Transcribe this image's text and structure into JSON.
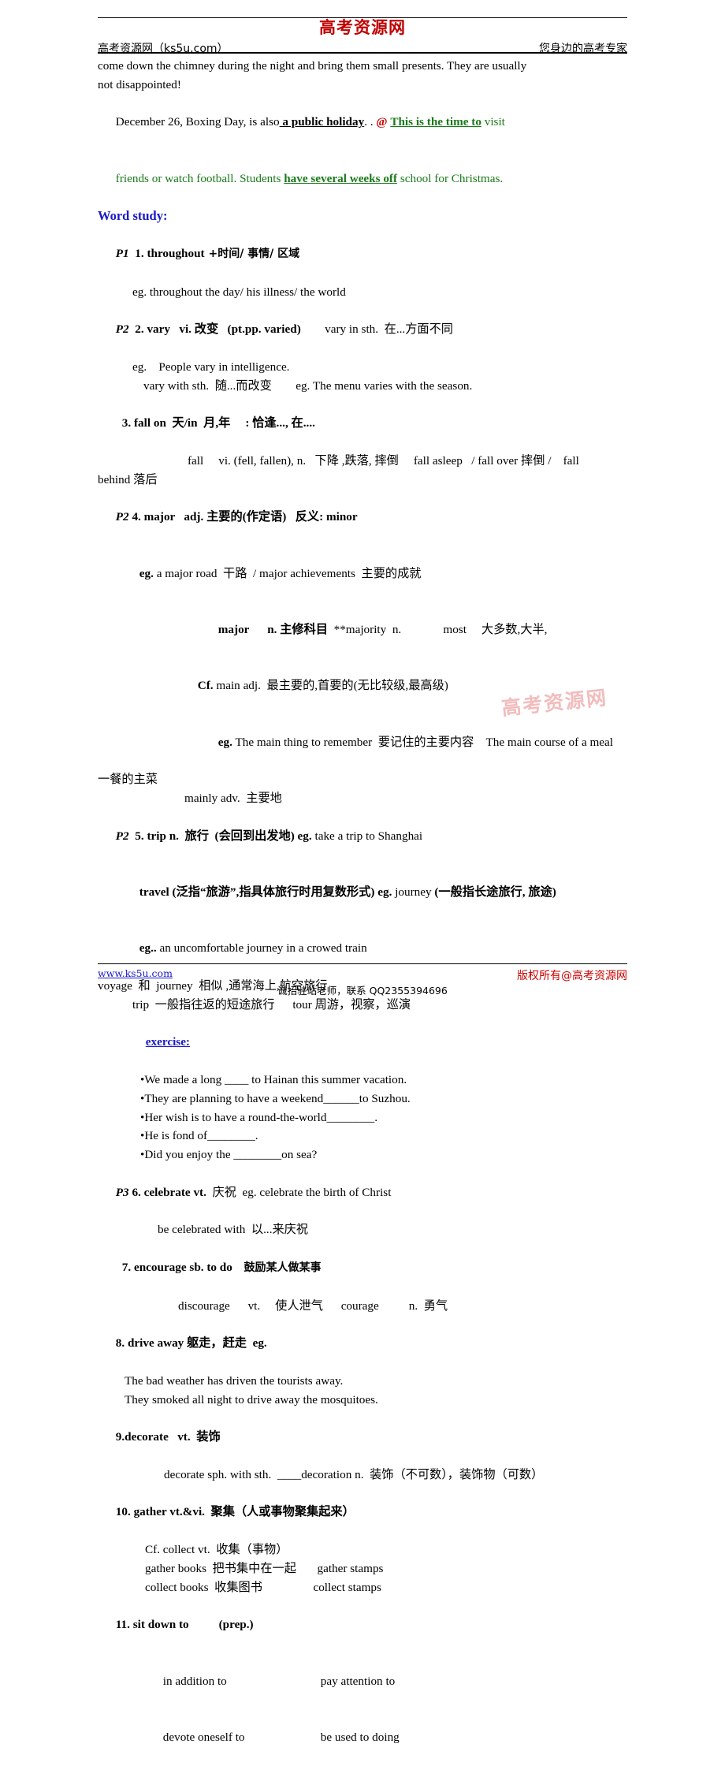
{
  "header": {
    "left": "高考资源网（ks5u.com）",
    "logo": "高考资源网",
    "right": "您身边的高考专家"
  },
  "watermark": "高考资源网",
  "footer": {
    "link": "www.ks5u.com",
    "center": "诚招驻站老师，联系 QQ2355394696",
    "right": "版权所有@高考资源网"
  },
  "colors": {
    "logo_red": "#c00000",
    "heading_blue": "#1a1ac8",
    "highlight_green": "#1a7a1a",
    "at_red": "#cc0000",
    "watermark_pink": "#f2bcbc"
  },
  "content": {
    "para_intro_line1": "come down the chimney during the night and bring them small presents. They are usually",
    "para_intro_line2": "not disappointed!",
    "boxing_pre": "December 26, Boxing Day, is also",
    "boxing_bold_underline": " a public holiday",
    "boxing_mid": ". . ",
    "boxing_at": "@",
    "boxing_green_bold": "This is the time to",
    "boxing_green_tail": " visit",
    "boxing_line2_a": "friends or watch football. Students ",
    "boxing_line2_bold": "have several weeks off",
    "boxing_line2_b": " school for Christmas.",
    "word_study_heading": "Word study:",
    "e1_plabel": "P1",
    "e1_term": "1. throughout",
    "e1_rest": " +时间/ 事情/ 区域",
    "e1_eg": "eg. throughout the day/ his illness/ the world",
    "e2_plabel": "P2",
    "e2_term": "2. vary   vi. 改变   (pt.pp. varied)",
    "e2_rest": "        vary in sth.  在...方面不同",
    "e2_eg1": "eg.    People vary in intelligence.",
    "e2_eg2": "vary with sth.  随...而改变        eg. The menu varies with the season.",
    "e3_term": "3. fall on",
    "e3_rest": "  天/in  月,年     : 恰逢..., 在....",
    "e3_line1": "fall     vi. (fell, fallen), n.   下降 ,跌落, 摔倒     fall asleep   / fall over 摔倒 /    fall",
    "e3_line2": "behind 落后",
    "e4_plabel": "P2",
    "e4_term": "4. major   adj. 主要的(作定语)   反义: minor",
    "e4_eg_bold": "eg.",
    "e4_eg_rest": " a major road  干路  / major achievements  主要的成就",
    "e4_major_n_bold": "major",
    "e4_major_n_bold2": "n. 主修科目",
    "e4_major_n_rest": "  **majority  n.              most     大多数,大半,",
    "e4_cf_bold": "Cf.",
    "e4_cf_rest": " main adj.  最主要的,首要的(无比较级,最高级)",
    "e4_eg2_bold": "eg.",
    "e4_eg2_rest": " The main thing to remember  要记住的主要内容    The main course of a meal",
    "e4_tail": "一餐的主菜",
    "e4_mainly": "mainly adv.  主要地",
    "e5_plabel": "P2",
    "e5_term": "5. trip n.  旅行  (会回到出发地) eg.",
    "e5_rest": " take a trip to Shanghai",
    "e5_travel_a": "travel (泛指“旅游”,指具体旅行时用复数形式) ",
    "e5_travel_eg": "eg.",
    "e5_travel_b": " journey ",
    "e5_travel_c": "(一般指长途旅行, 旅途)",
    "e5_eg_bold": "eg..",
    "e5_eg_rest": " an uncomfortable journey in a crowed train",
    "e5_voyage": "voyage  和  journey  相似 ,通常海上,航空旅行",
    "e5_trip_tour": "trip  一般指往返的短途旅行      tour 周游，视察，巡演",
    "exercise_heading": "exercise:",
    "ex1": "•We made a long ____ to Hainan this summer vacation.",
    "ex2": "•They are planning to have a weekend______to Suzhou.",
    "ex3": "•Her wish is to have a round-the-world________.",
    "ex4": "•He is fond of________.",
    "ex5": "•Did you enjoy the ________on sea?",
    "e6_plabel": "P3",
    "e6_term": "6. celebrate vt.",
    "e6_rest": "  庆祝  eg. celebrate the birth of Christ",
    "e6_line2": "be celebrated with  以...来庆祝",
    "e7_term": "7. encourage sb. to do",
    "e7_rest": "   鼓励某人做某事",
    "e7_line2": "discourage      vt.     使人泄气      courage          n.  勇气",
    "e8_term": "8. drive away 躯走，赶走  eg.",
    "e8_line1": "The bad weather has driven the tourists away.",
    "e8_line2": "They smoked all night to drive away the mosquitoes.",
    "e9_term": "9.decorate   vt.  装饰",
    "e9_line1": "decorate sph. with sth.  ____decoration n.  装饰（不可数），装饰物（可数）",
    "e10_term": "10. gather vt.&vi.  聚集（人或事物聚集起来）",
    "e10_line1": "Cf. collect vt.  收集（事物）",
    "e10_line2": "gather books  把书集中在一起       gather stamps",
    "e10_line3": "collect books  收集图书                 collect stamps",
    "e11_term": "11. sit down to",
    "e11_rest": "          (prep.)",
    "e11_line1_a": "in addition to",
    "e11_line1_b": "pay attention to",
    "e11_line2_a": "devote oneself to",
    "e11_line2_b": "be used to doing"
  }
}
